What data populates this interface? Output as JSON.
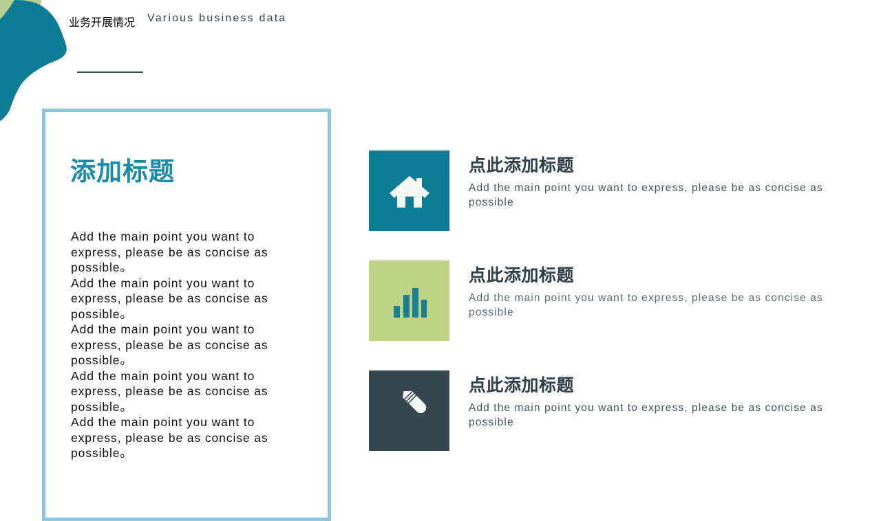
{
  "header": {
    "title": "业务开展情况",
    "subtitle": "Various business data",
    "underline_icon": "horizontal-rule-icon"
  },
  "decor": {
    "blob_back_color": "#b6cf8e",
    "blob_front_color": "#0d7d96",
    "icon": "organic-blob-decoration"
  },
  "left_panel": {
    "border_color": "#8cc5dc",
    "title": "添加标题",
    "title_color": "#1a8ca8",
    "paragraphs": [
      "Add the main point you want to express, please be as concise as possible。",
      "Add the main point you want to express, please be as concise as possible。",
      "Add the main point you want to express, please be as concise as possible。",
      "Add the main point you want to express, please be as concise as possible。",
      "Add the main point you want to express, please be as concise as possible。"
    ]
  },
  "features": [
    {
      "icon": "home-icon",
      "tile_color": "#0d7d96",
      "icon_color": "#f4f7f2",
      "title": "点此添加标题",
      "description": "Add the main point you want to express, please be as concise as possible"
    },
    {
      "icon": "bar-chart-icon",
      "tile_color": "#bed285",
      "icon_color": "#187f95",
      "title": "点此添加标题",
      "description": "Add the main point you want to express, please be as concise as possible"
    },
    {
      "icon": "pencil-icon",
      "tile_color": "#36474f",
      "icon_color": "#f4f7f2",
      "title": "点此添加标题",
      "description": "Add the main point you want to express, please be as concise as possible"
    }
  ]
}
